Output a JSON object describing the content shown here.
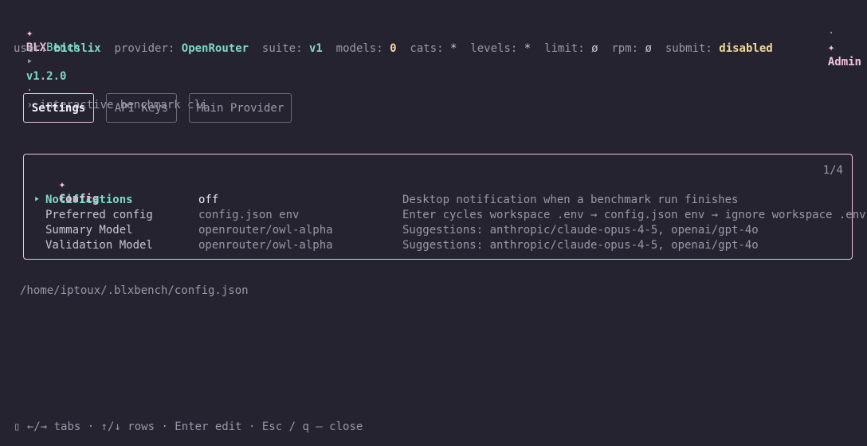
{
  "header": {
    "logo_glyph": "✦",
    "app_name_prefix": "BLX",
    "app_name_suffix": "Bench",
    "version_marker": "‣",
    "version": "v1.2.0",
    "separator": "·",
    "subtitle": "› interactive benchmark cli",
    "right_separator": "·",
    "admin_glyph": "✦",
    "admin_label": "Admin"
  },
  "status": {
    "user_label": "user:",
    "user_value": "bitslix",
    "provider_label": "provider:",
    "provider_value": "OpenRouter",
    "suite_label": "suite:",
    "suite_value": "v1",
    "models_label": "models:",
    "models_value": "0",
    "cats_label": "cats:",
    "cats_value": "*",
    "levels_label": "levels:",
    "levels_value": "*",
    "limit_label": "limit:",
    "limit_value": "ø",
    "rpm_label": "rpm:",
    "rpm_value": "ø",
    "submit_label": "submit:",
    "submit_value": "disabled"
  },
  "tabs": [
    {
      "label": "Settings",
      "active": true
    },
    {
      "label": "API Keys",
      "active": false
    },
    {
      "label": "Main Provider",
      "active": false
    }
  ],
  "panel": {
    "title_glyph": "✦",
    "title": "Config",
    "page": "1/4",
    "selected_marker": "‣",
    "rows": [
      {
        "name": "Notifications",
        "value": "off",
        "description": "Desktop notification when a benchmark run finishes",
        "selected": true
      },
      {
        "name": "Preferred config",
        "value": "config.json env",
        "description": "Enter cycles workspace .env → config.json env → ignore workspace .env",
        "selected": false
      },
      {
        "name": "Summary Model",
        "value": "openrouter/owl-alpha",
        "description": "Suggestions: anthropic/claude-opus-4-5, openai/gpt-4o",
        "selected": false
      },
      {
        "name": "Validation Model",
        "value": "openrouter/owl-alpha",
        "description": "Suggestions: anthropic/claude-opus-4-5, openai/gpt-4o",
        "selected": false
      }
    ]
  },
  "config_path": "/home/iptoux/.blxbench/config.json",
  "footer": {
    "icon": "▯",
    "hint": "←/→ tabs · ↑/↓ rows · Enter edit · Esc / q — close"
  },
  "colors": {
    "background": "#24232f",
    "accent_pink": "#f3c2dc",
    "accent_teal": "#7fd8c8",
    "accent_yellow": "#f2d99a"
  }
}
